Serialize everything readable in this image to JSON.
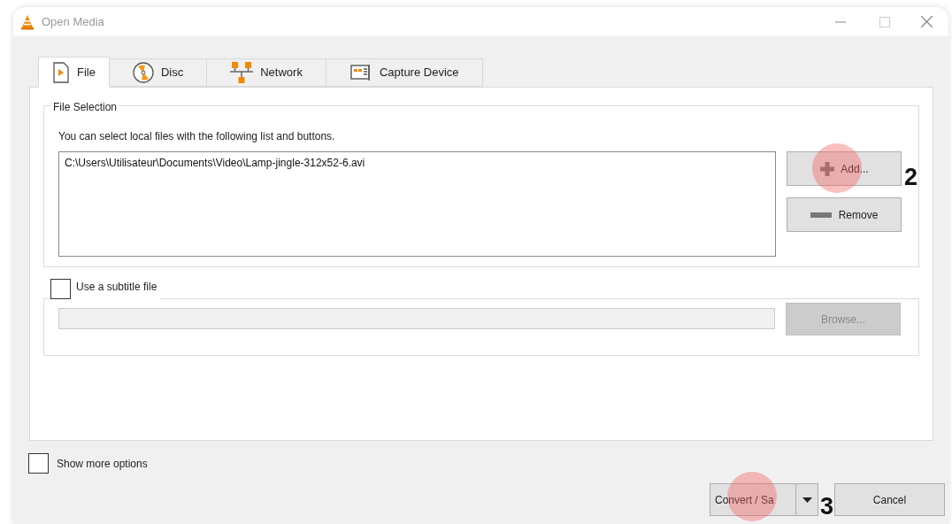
{
  "window": {
    "title": "Open Media"
  },
  "tabs": [
    {
      "label": "File",
      "kind": "file",
      "selected": true
    },
    {
      "label": "Disc",
      "kind": "disc",
      "selected": false
    },
    {
      "label": "Network",
      "kind": "network",
      "selected": false
    },
    {
      "label": "Capture Device",
      "kind": "capture",
      "selected": false
    }
  ],
  "file_selection": {
    "legend": "File Selection",
    "hint": "You can select local files with the following list and buttons.",
    "files": [
      "C:\\Users\\Utilisateur\\Documents\\Video\\Lamp-jingle-312x52-6.avi"
    ],
    "add_button": "Add...",
    "remove_button": "Remove",
    "add_marker": "2"
  },
  "subtitle": {
    "label": "Use a subtitle file",
    "checked": false,
    "browse_button": "Browse...",
    "browse_disabled": true
  },
  "show_more_options": {
    "label": "Show more options",
    "checked": false
  },
  "convert_button": "Convert / Sa",
  "convert_marker": "3",
  "cancel_button": "Cancel"
}
